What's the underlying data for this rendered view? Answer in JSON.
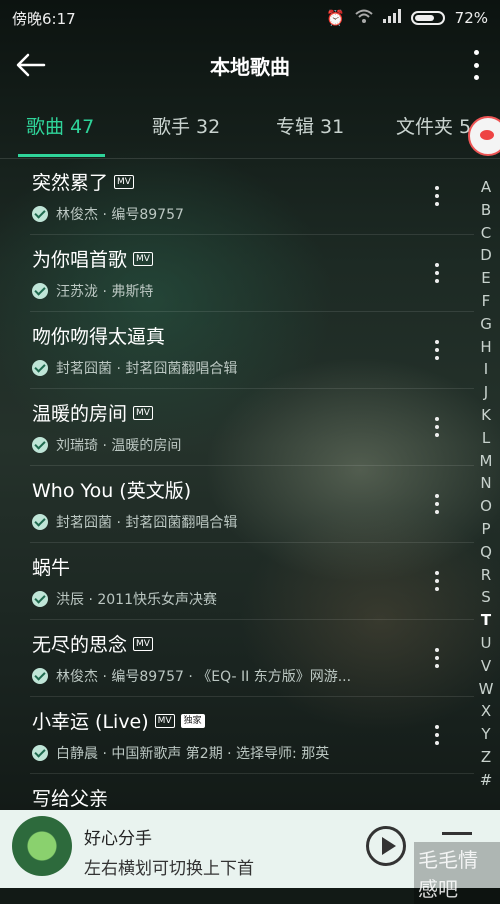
{
  "status": {
    "carrier": "傍晚6:17",
    "battery": "72%"
  },
  "appbar": {
    "title": "本地歌曲"
  },
  "tabs": [
    {
      "label": "歌曲 47"
    },
    {
      "label": "歌手 32"
    },
    {
      "label": "专辑 31"
    },
    {
      "label": "文件夹 5"
    }
  ],
  "songs": [
    {
      "title": "突然累了",
      "tags": [
        "MV"
      ],
      "sub": "林俊杰 · 编号89757"
    },
    {
      "title": "为你唱首歌",
      "tags": [
        "MV"
      ],
      "sub": "汪苏泷 · 弗斯特"
    },
    {
      "title": "吻你吻得太逼真",
      "tags": [],
      "sub": "封茗囧菌 · 封茗囧菌翻唱合辑"
    },
    {
      "title": "温暖的房间",
      "tags": [
        "MV"
      ],
      "sub": "刘瑞琦 · 温暖的房间"
    },
    {
      "title": "Who You (英文版)",
      "tags": [],
      "sub": "封茗囧菌 · 封茗囧菌翻唱合辑"
    },
    {
      "title": "蜗牛",
      "tags": [],
      "sub": "洪辰 · 2011快乐女声决赛"
    },
    {
      "title": "无尽的思念",
      "tags": [
        "MV"
      ],
      "sub": "林俊杰 · 编号89757 · 《EQ- II 东方版》网游..."
    },
    {
      "title": "小幸运 (Live)",
      "tags": [
        "MV",
        "独家"
      ],
      "sub": "白静晨 · 中国新歌声 第2期 · 选择导师: 那英"
    },
    {
      "title": "写给父亲",
      "tags": [],
      "sub": ""
    }
  ],
  "index_letters": [
    "A",
    "B",
    "C",
    "D",
    "E",
    "F",
    "G",
    "H",
    "I",
    "J",
    "K",
    "L",
    "M",
    "N",
    "O",
    "P",
    "Q",
    "R",
    "S",
    "T",
    "U",
    "V",
    "W",
    "X",
    "Y",
    "Z",
    "#"
  ],
  "index_active": "T",
  "player": {
    "title": "好心分手",
    "subtitle": "左右横划可切换上下首"
  },
  "watermark": "毛毛情感吧",
  "colors": {
    "accent": "#2fd49a"
  }
}
